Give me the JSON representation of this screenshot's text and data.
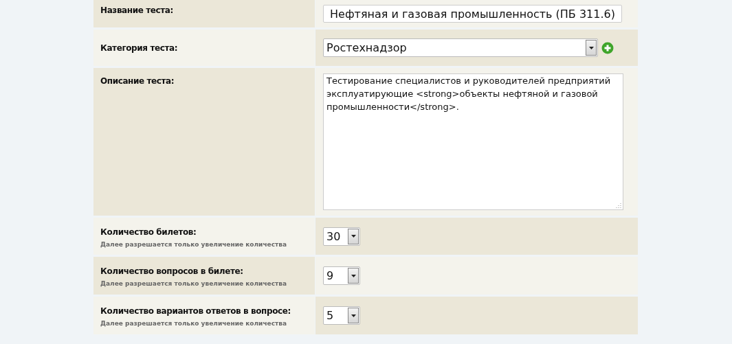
{
  "form": {
    "rows": [
      {
        "kind": "text",
        "label": "Название теста:",
        "value": "Нефтяная и газовая промышленность (ПБ 311.6)"
      },
      {
        "kind": "select",
        "label": "Категория теста:",
        "value": "Ростехнадзор",
        "add_button": true
      },
      {
        "kind": "textarea",
        "label": "Описание теста:",
        "value": "Тестирование специалистов и руководителей предприятий эксплуатирующие <strong>объекты нефтяной и газовой промышленности</strong>."
      },
      {
        "kind": "number",
        "label": "Количество билетов:",
        "hint": "Далее разрешается только увеличение количества",
        "value": "30"
      },
      {
        "kind": "number",
        "label": "Количество вопросов в билете:",
        "hint": "Далее разрешается только увеличение количества",
        "value": "9"
      },
      {
        "kind": "number",
        "label": "Количество вариантов ответов в вопросе:",
        "hint": "Далее разрешается только увеличение количества",
        "value": "5"
      }
    ]
  }
}
